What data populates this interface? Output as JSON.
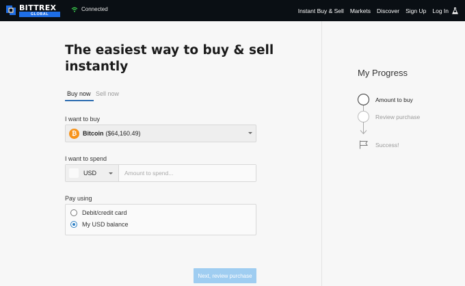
{
  "header": {
    "logo_text": "BITTREX",
    "logo_badge": "GLOBAL",
    "connection_status": "Connected",
    "nav": [
      "Instant Buy & Sell",
      "Markets",
      "Discover",
      "Sign Up",
      "Log In"
    ]
  },
  "main": {
    "headline": "The easiest way to buy & sell instantly",
    "tabs": [
      {
        "label": "Buy now",
        "active": true
      },
      {
        "label": "Sell now",
        "active": false
      }
    ],
    "buy": {
      "label": "I want to buy",
      "coin_symbol": "₿",
      "coin_name": "Bitcoin",
      "coin_price": "($64,160.49)"
    },
    "spend": {
      "label": "I want to spend",
      "currency": "USD",
      "amount_placeholder": "Amount to spend..."
    },
    "pay": {
      "label": "Pay using",
      "options": [
        {
          "label": "Debit/credit card",
          "checked": false
        },
        {
          "label": "My USD balance",
          "checked": true
        }
      ]
    },
    "next_button": "Next, review purchase"
  },
  "progress": {
    "title": "My Progress",
    "steps": [
      {
        "label": "Amount to buy",
        "state": "current"
      },
      {
        "label": "Review purchase",
        "state": "pending"
      },
      {
        "label": "Success!",
        "state": "pending"
      }
    ]
  },
  "colors": {
    "topbar_bg": "#0a0f14",
    "brand_blue": "#1e6ee6",
    "tab_underline": "#2b6cb0",
    "bitcoin_orange": "#f7931a",
    "button_disabled": "#9fcdf1",
    "wifi_green": "#3ccf4e"
  }
}
